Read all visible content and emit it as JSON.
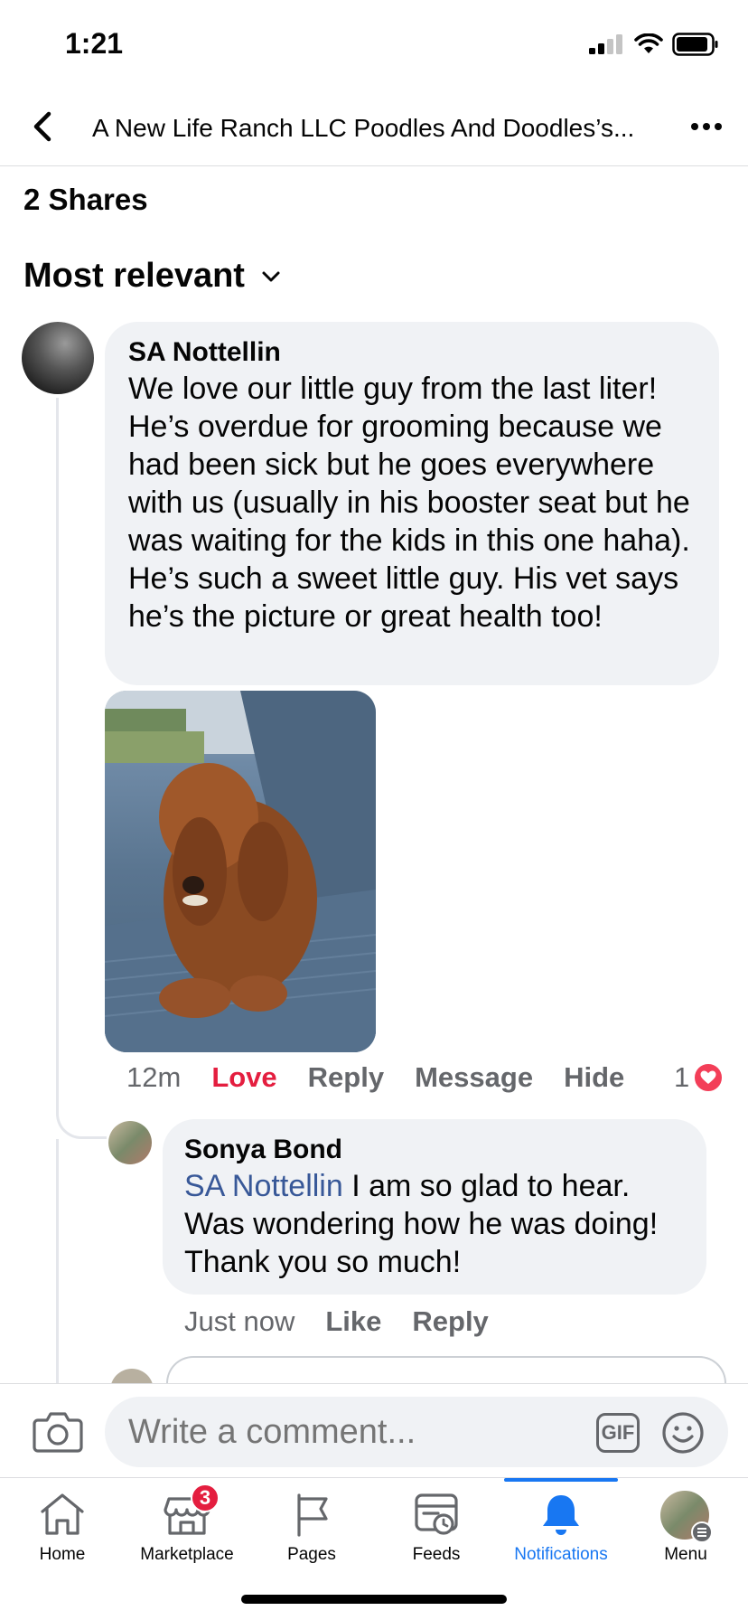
{
  "status_bar": {
    "time": "1:21"
  },
  "header": {
    "title": "A New Life Ranch LLC Poodles And Doodles’s..."
  },
  "shares": "2 Shares",
  "sort": {
    "label": "Most relevant"
  },
  "comments": [
    {
      "author": "SA Nottellin",
      "text": "We love our little guy from the last liter! He’s overdue for grooming because we had been sick but he goes everywhere with us (usually in his booster seat but he was waiting for the kids in this one haha). He’s such a sweet little guy. His vet says he’s the picture or great health too!",
      "time": "12m",
      "actions": {
        "love": "Love",
        "reply": "Reply",
        "message": "Message",
        "hide": "Hide"
      },
      "reaction_count": "1"
    },
    {
      "author": "Sonya Bond",
      "mention": "SA Nottellin",
      "text": " I am so glad to hear. Was wondering how he was doing! Thank you so much!",
      "time": "Just now",
      "actions": {
        "like": "Like",
        "reply": "Reply"
      }
    }
  ],
  "composer": {
    "placeholder": "Write a comment...",
    "gif": "GIF"
  },
  "nav": {
    "items": [
      {
        "label": "Home"
      },
      {
        "label": "Marketplace",
        "badge": "3"
      },
      {
        "label": "Pages"
      },
      {
        "label": "Feeds"
      },
      {
        "label": "Notifications"
      },
      {
        "label": "Menu"
      }
    ]
  },
  "colors": {
    "accent": "#1877f2",
    "love": "#e41e3f",
    "bubble": "#f0f2f5",
    "mention": "#385898"
  }
}
